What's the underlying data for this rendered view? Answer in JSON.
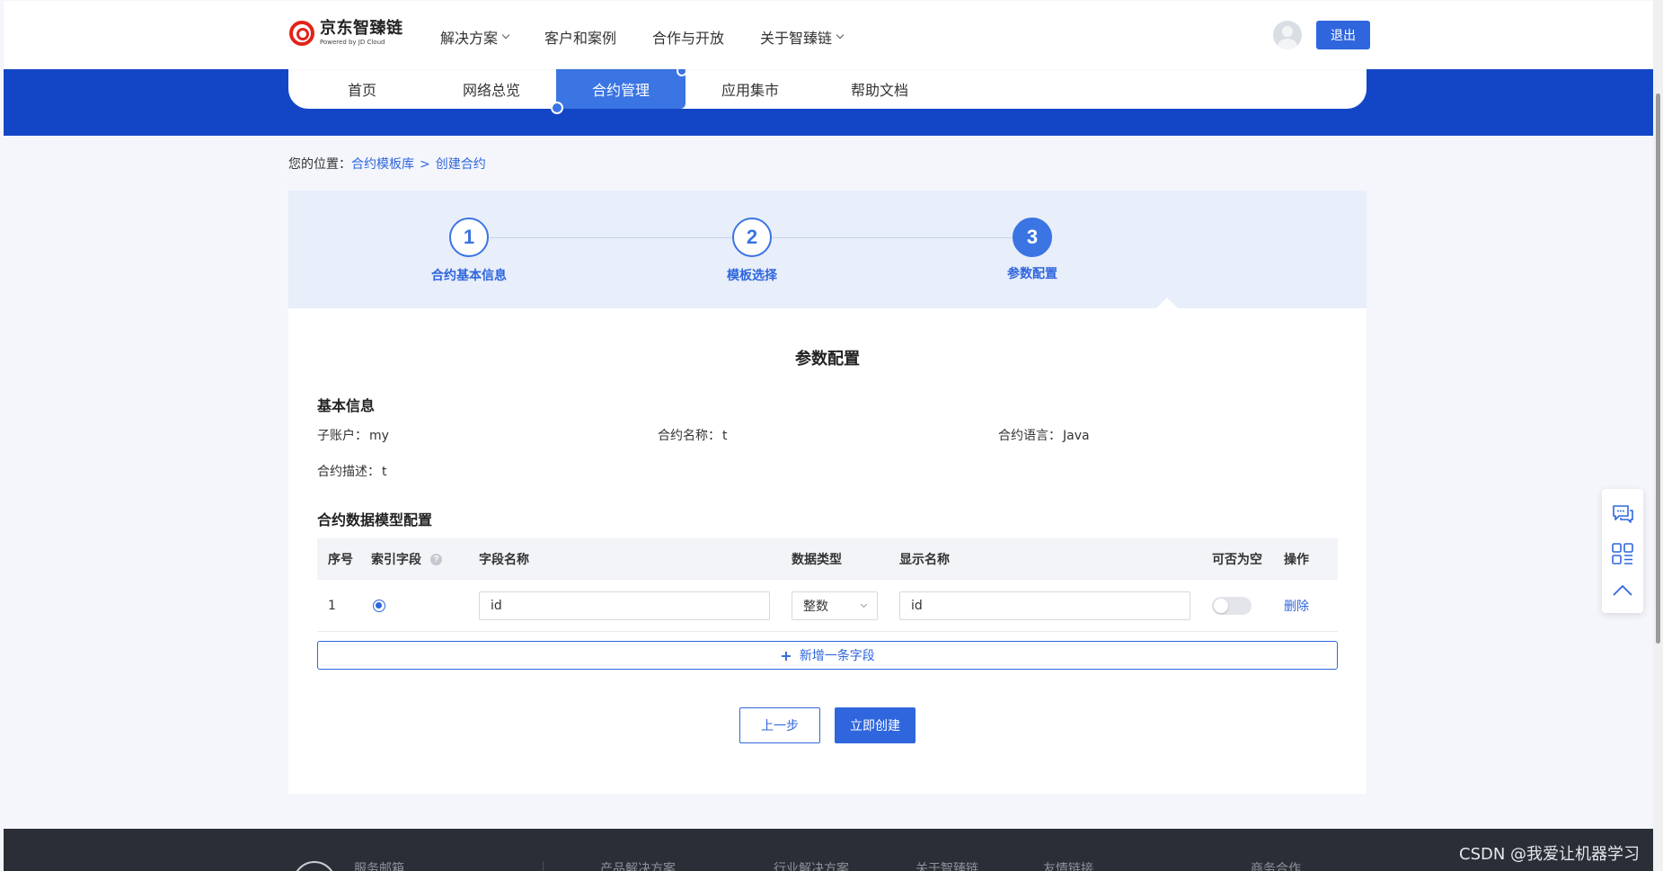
{
  "header": {
    "logo_cn": "京东智臻链",
    "logo_en": "Powered by JD Cloud",
    "nav": [
      {
        "label": "解决方案",
        "dropdown": true
      },
      {
        "label": "客户和案例",
        "dropdown": false
      },
      {
        "label": "合作与开放",
        "dropdown": false
      },
      {
        "label": "关于智臻链",
        "dropdown": true
      }
    ],
    "logout_label": "退出"
  },
  "tabs": [
    {
      "label": "首页",
      "active": false
    },
    {
      "label": "网络总览",
      "active": false
    },
    {
      "label": "合约管理",
      "active": true
    },
    {
      "label": "应用集市",
      "active": false
    },
    {
      "label": "帮助文档",
      "active": false
    }
  ],
  "breadcrumb": {
    "prefix": "您的位置：",
    "items": [
      "合约模板库",
      "创建合约"
    ],
    "separator": ">"
  },
  "steps": [
    {
      "number": "1",
      "label": "合约基本信息",
      "state": "done"
    },
    {
      "number": "2",
      "label": "模板选择",
      "state": "done"
    },
    {
      "number": "3",
      "label": "参数配置",
      "state": "current"
    }
  ],
  "panel": {
    "title": "参数配置",
    "basic_section_title": "基本信息",
    "info": {
      "subaccount_label": "子账户：",
      "subaccount_value": "my",
      "name_label": "合约名称：",
      "name_value": "t",
      "language_label": "合约语言：",
      "language_value": "Java",
      "desc_label": "合约描述：",
      "desc_value": "t"
    },
    "model_section_title": "合约数据模型配置",
    "table": {
      "columns": {
        "index": "序号",
        "key": "索引字段",
        "field_name": "字段名称",
        "data_type": "数据类型",
        "display_name": "显示名称",
        "nullable": "可否为空",
        "action": "操作"
      },
      "rows": [
        {
          "index": "1",
          "is_key": true,
          "field_name": "id",
          "data_type": "整数",
          "display_name": "id",
          "nullable": false,
          "action": "删除"
        }
      ]
    },
    "add_row_label": "新增一条字段",
    "prev_label": "上一步",
    "create_label": "立即创建"
  },
  "footer": {
    "items": [
      "服务邮箱",
      "产品解决方案",
      "行业解决方案",
      "关于智臻链",
      "友情链接",
      "商务合作"
    ]
  },
  "watermark": "CSDN @我爱让机器学习",
  "colors": {
    "brand_blue": "#1346c7",
    "accent": "#2f66dd",
    "logo_red": "#e2231a"
  }
}
